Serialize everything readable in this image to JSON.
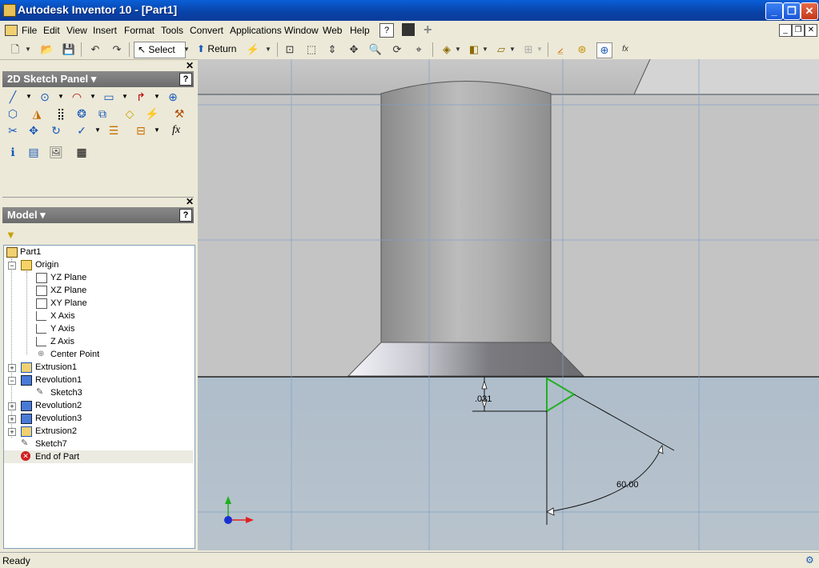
{
  "window": {
    "title": "Autodesk Inventor 10 - [Part1]",
    "minimize": "_",
    "maximize": "❐",
    "close": "✕"
  },
  "menubar": {
    "items": [
      "File",
      "Edit",
      "View",
      "Insert",
      "Format",
      "Tools",
      "Convert",
      "Applications",
      "Window",
      "Web",
      "Help"
    ]
  },
  "toolbar": {
    "select_label": "Select",
    "return_label": "Return"
  },
  "sketch_panel": {
    "title": "2D Sketch Panel ▾",
    "help": "?"
  },
  "model_panel": {
    "title": "Model ▾",
    "help": "?"
  },
  "tree": {
    "part": "Part1",
    "origin": "Origin",
    "origin_items": [
      "YZ Plane",
      "XZ Plane",
      "XY Plane",
      "X Axis",
      "Y Axis",
      "Z Axis",
      "Center Point"
    ],
    "features": {
      "extrusion1": "Extrusion1",
      "revolution1": "Revolution1",
      "sketch3": "Sketch3",
      "revolution2": "Revolution2",
      "revolution3": "Revolution3",
      "extrusion2": "Extrusion2",
      "sketch7": "Sketch7",
      "end_of_part": "End of Part"
    }
  },
  "viewport": {
    "dim_linear": ".031",
    "dim_angle": "60.00"
  },
  "status": {
    "text": "Ready"
  }
}
